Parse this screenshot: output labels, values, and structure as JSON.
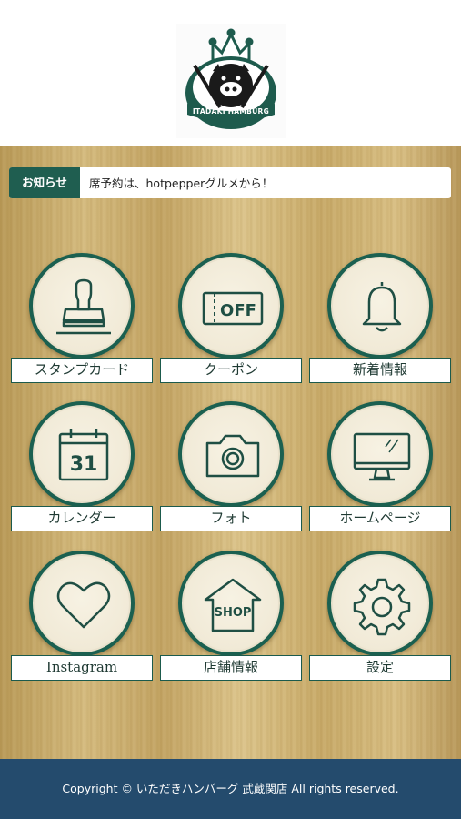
{
  "header": {
    "logo": {
      "text": "ITADAKI HAMBURG",
      "icon": "pig-crown-logo"
    }
  },
  "notice": {
    "label": "お知らせ",
    "message": "席予約は、hotpepperグルメから！"
  },
  "menu": [
    {
      "label": "スタンプカード",
      "icon": "stamp-icon"
    },
    {
      "label": "クーポン",
      "icon": "coupon-off-icon",
      "icon_text": "OFF"
    },
    {
      "label": "新着情報",
      "icon": "bell-icon"
    },
    {
      "label": "カレンダー",
      "icon": "calendar-icon",
      "icon_text": "31"
    },
    {
      "label": "フォト",
      "icon": "camera-icon"
    },
    {
      "label": "ホームページ",
      "icon": "monitor-icon"
    },
    {
      "label": "Instagram",
      "icon": "heart-icon"
    },
    {
      "label": "店舗情報",
      "icon": "shop-icon",
      "icon_text": "SHOP"
    },
    {
      "label": "設定",
      "icon": "gear-icon"
    }
  ],
  "footer": {
    "copyright": "Copyright © いただきハンバーグ 武蔵関店 All rights reserved."
  },
  "colors": {
    "accent_green": "#1b6050",
    "footer_blue": "#244b6d",
    "wood": "#cdb273"
  }
}
